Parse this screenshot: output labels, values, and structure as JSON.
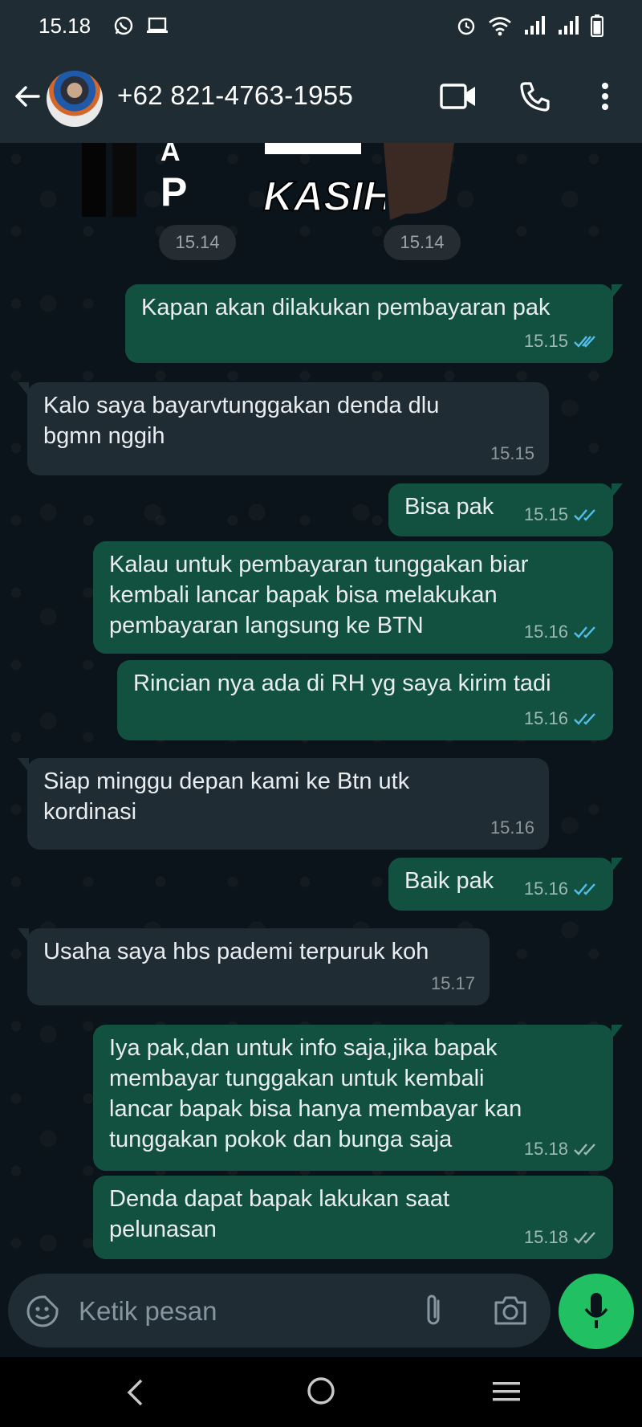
{
  "status_bar": {
    "time": "15.18",
    "left_icons": [
      "whatsapp-icon",
      "laptop-icon"
    ],
    "right_icons": [
      "alarm-icon",
      "wifi-icon",
      "signal-icon",
      "signal-icon",
      "battery-icon"
    ]
  },
  "header": {
    "contact_name": "+62 821-4763-1955"
  },
  "sticker_times": [
    "15.14",
    "15.14"
  ],
  "messages": [
    {
      "dir": "out",
      "lines": [
        "Kapan akan dilakukan pembayaran pak"
      ],
      "time": "15.15",
      "status": "read"
    },
    {
      "dir": "in",
      "lines": [
        "Kalo saya bayarvtunggakan denda dlu",
        "bgmn nggih"
      ],
      "time": "15.15"
    },
    {
      "dir": "out",
      "lines": [
        "Bisa pak"
      ],
      "time": "15.15",
      "status": "read"
    },
    {
      "dir": "out",
      "lines": [
        "Kalau untuk pembayaran tunggakan biar",
        "kembali lancar bapak bisa melakukan",
        "pembayaran langsung ke BTN"
      ],
      "time": "15.16",
      "status": "read"
    },
    {
      "dir": "out",
      "lines": [
        "Rincian nya ada di RH yg saya kirim tadi"
      ],
      "time": "15.16",
      "status": "read"
    },
    {
      "dir": "in",
      "lines": [
        "Siap minggu depan kami ke Btn utk",
        "kordinasi"
      ],
      "time": "15.16"
    },
    {
      "dir": "out",
      "lines": [
        "Baik pak"
      ],
      "time": "15.16",
      "status": "read"
    },
    {
      "dir": "in",
      "lines": [
        "Usaha saya hbs pademi terpuruk koh"
      ],
      "time": "15.17"
    },
    {
      "dir": "out",
      "lines": [
        "Iya pak,dan untuk info saja,jika bapak",
        "membayar tunggakan untuk kembali",
        "lancar bapak bisa hanya membayar kan",
        "tunggakan pokok dan bunga saja"
      ],
      "time": "15.18",
      "status": "delivered"
    },
    {
      "dir": "out",
      "lines": [
        "Denda dapat bapak lakukan saat",
        "pelunasan"
      ],
      "time": "15.18",
      "status": "delivered"
    }
  ],
  "composer": {
    "placeholder": "Ketik pesan"
  },
  "colors": {
    "outgoing_bubble": "#125140",
    "incoming_bubble": "#202c33",
    "read_tick": "#53bdeb",
    "mic_button": "#21c063"
  }
}
